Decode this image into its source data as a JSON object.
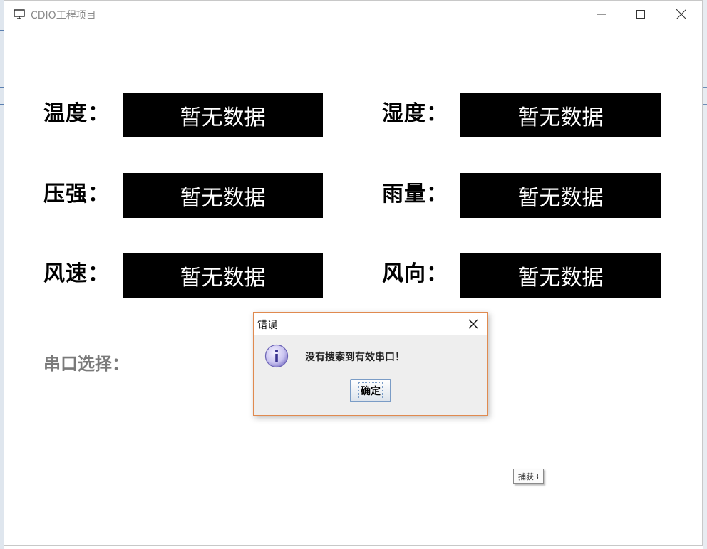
{
  "window": {
    "title": "CDIO工程项目"
  },
  "metrics": [
    {
      "label": "温度：",
      "value": "暂无数据"
    },
    {
      "label": "湿度：",
      "value": "暂无数据"
    },
    {
      "label": "压强：",
      "value": "暂无数据"
    },
    {
      "label": "雨量：",
      "value": "暂无数据"
    },
    {
      "label": "风速：",
      "value": "暂无数据"
    },
    {
      "label": "风向：",
      "value": "暂无数据"
    }
  ],
  "serial": {
    "label": "串口选择："
  },
  "dialog": {
    "title": "错误",
    "message": "没有搜索到有效串口！",
    "ok_label": "确定",
    "icon": "info-icon",
    "border_color": "#e08a4f"
  },
  "tooltip": {
    "text": "捕获3"
  },
  "colors": {
    "value_box_bg": "#000000",
    "value_box_text": "#ffffff",
    "serial_label": "#7a7a7a"
  }
}
